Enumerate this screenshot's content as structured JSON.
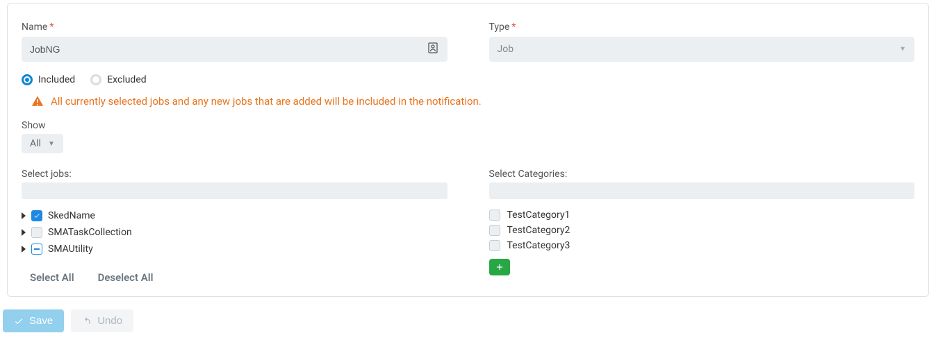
{
  "fields": {
    "name": {
      "label": "Name",
      "value": "JobNG",
      "required": true
    },
    "type": {
      "label": "Type",
      "value": "Job",
      "required": true
    }
  },
  "scope": {
    "included_label": "Included",
    "excluded_label": "Excluded",
    "selected": "included",
    "warning_text": "All currently selected jobs and any new jobs that are added will be included in the notification."
  },
  "show": {
    "label": "Show",
    "value": "All"
  },
  "jobs": {
    "label": "Select jobs:",
    "items": [
      {
        "name": "SkedName",
        "state": "checked"
      },
      {
        "name": "SMATaskCollection",
        "state": "unchecked"
      },
      {
        "name": "SMAUtility",
        "state": "indeterminate"
      }
    ],
    "select_all_label": "Select All",
    "deselect_all_label": "Deselect All"
  },
  "categories": {
    "label": "Select Categories:",
    "items": [
      {
        "name": "TestCategory1",
        "state": "unchecked"
      },
      {
        "name": "TestCategory2",
        "state": "unchecked"
      },
      {
        "name": "TestCategory3",
        "state": "unchecked"
      }
    ]
  },
  "footer": {
    "save_label": "Save",
    "undo_label": "Undo"
  }
}
